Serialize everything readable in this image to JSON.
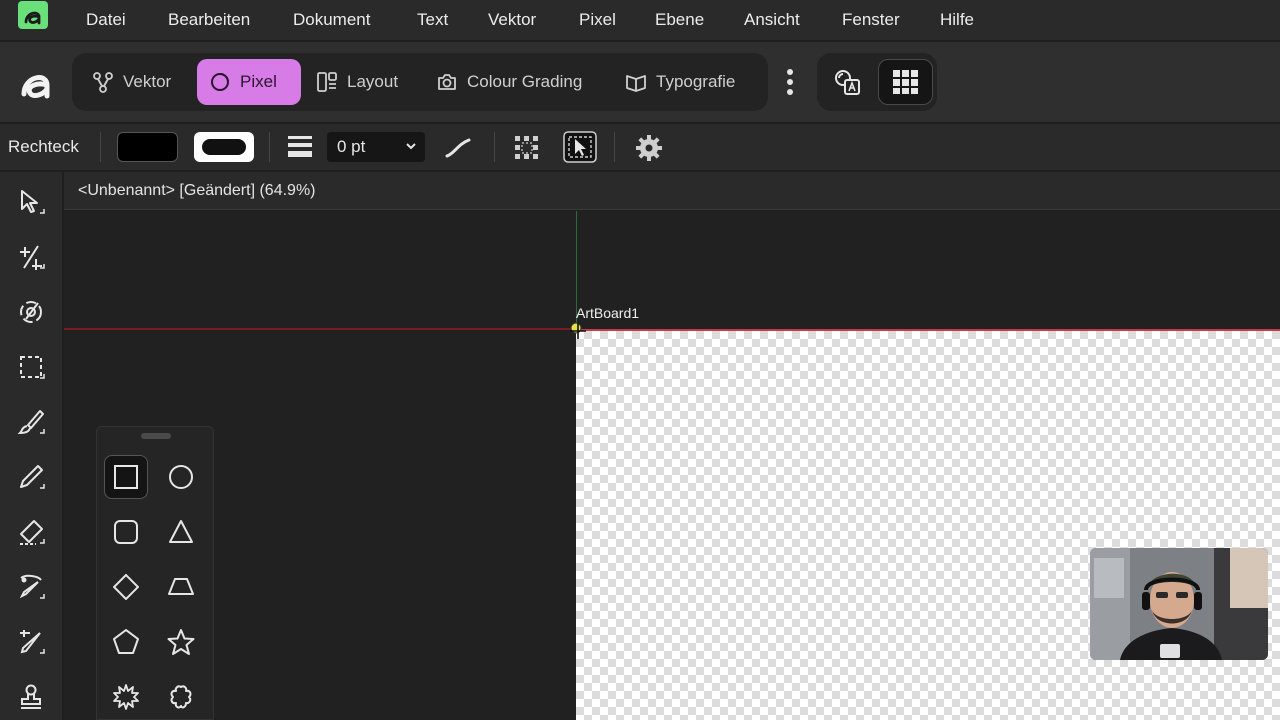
{
  "menu": {
    "items": [
      "Datei",
      "Bearbeiten",
      "Dokument",
      "Text",
      "Vektor",
      "Pixel",
      "Ebene",
      "Ansicht",
      "Fenster",
      "Hilfe"
    ]
  },
  "personas": [
    {
      "label": "Vektor",
      "icon": "vector-nodes-icon",
      "active": false
    },
    {
      "label": "Pixel",
      "icon": "pixel-brush-icon",
      "active": true
    },
    {
      "label": "Layout",
      "icon": "layout-icon",
      "active": false
    },
    {
      "label": "Colour Grading",
      "icon": "camera-icon",
      "active": false
    },
    {
      "label": "Typografie",
      "icon": "book-icon",
      "active": false
    }
  ],
  "context": {
    "tool_name": "Rechteck",
    "stroke_width": "0 pt",
    "fill_color": "#000000",
    "stroke_color": "#ffffff"
  },
  "document": {
    "tab_title": "<Unbenannt> [Geändert] (64.9%)",
    "artboard_label": "ArtBoard1"
  },
  "colors": {
    "accent_persona": "#d77be6",
    "app_badge": "#6ae07a"
  },
  "tools": [
    "move-tool-icon",
    "transform-tool-icon",
    "node-tool-icon",
    "marquee-tool-icon",
    "brush-tool-icon",
    "pencil-tool-icon",
    "eraser-tool-icon",
    "pen-tool-icon",
    "vector-pen-tool-icon",
    "stamp-tool-icon"
  ],
  "shapes": [
    "rectangle",
    "ellipse",
    "rounded-rectangle",
    "triangle",
    "diamond",
    "trapezoid",
    "pentagon",
    "star",
    "burst",
    "cloud"
  ]
}
